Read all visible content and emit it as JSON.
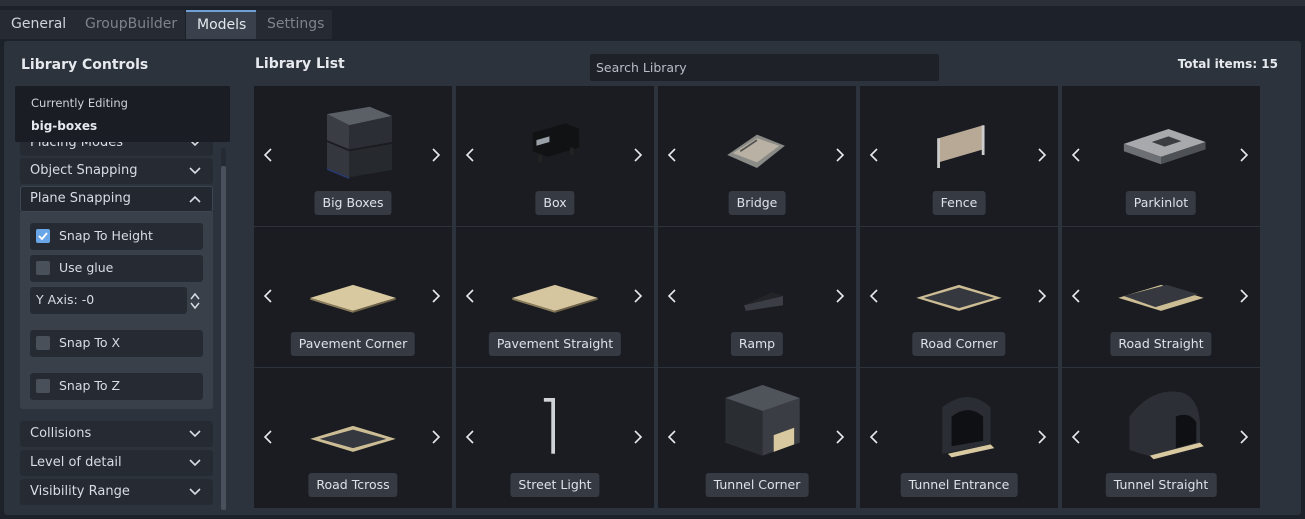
{
  "tabs": [
    {
      "label": "General"
    },
    {
      "label": "GroupBuilder"
    },
    {
      "label": "Models"
    },
    {
      "label": "Settings"
    }
  ],
  "left_panel": {
    "title": "Library Controls",
    "currently_editing_label": "Currently Editing",
    "currently_editing_value": "big-boxes",
    "placing_modes": "Placing Modes",
    "object_snapping": "Object Snapping",
    "plane_snapping": "Plane Snapping",
    "snap_to_height": "Snap To Height",
    "use_glue": "Use glue",
    "y_axis": "Y Axis:  -0",
    "snap_to_x": "Snap To X",
    "snap_to_z": "Snap To Z",
    "collisions": "Collisions",
    "level_of_detail": "Level of detail",
    "visibility_range": "Visibility Range"
  },
  "library": {
    "title": "Library List",
    "search_placeholder": "Search Library",
    "total": "Total items: 15",
    "items": [
      {
        "name": "Big Boxes",
        "icon": "big-boxes-model"
      },
      {
        "name": "Box",
        "icon": "box-model"
      },
      {
        "name": "Bridge",
        "icon": "bridge-model"
      },
      {
        "name": "Fence",
        "icon": "fence-model"
      },
      {
        "name": "Parkinlot",
        "icon": "parking-lot-model"
      },
      {
        "name": "Pavement Corner",
        "icon": "pavement-corner-model"
      },
      {
        "name": "Pavement Straight",
        "icon": "pavement-straight-model"
      },
      {
        "name": "Ramp",
        "icon": "ramp-model"
      },
      {
        "name": "Road Corner",
        "icon": "road-corner-model"
      },
      {
        "name": "Road Straight",
        "icon": "road-straight-model"
      },
      {
        "name": "Road Tcross",
        "icon": "road-tcross-model"
      },
      {
        "name": "Street Light",
        "icon": "street-light-model"
      },
      {
        "name": "Tunnel Corner",
        "icon": "tunnel-corner-model"
      },
      {
        "name": "Tunnel Entrance",
        "icon": "tunnel-entrance-model"
      },
      {
        "name": "Tunnel Straight",
        "icon": "tunnel-straight-model"
      }
    ]
  },
  "state": {
    "snap_to_height": true,
    "use_glue": false,
    "snap_to_x": false,
    "snap_to_z": false
  },
  "colors": {
    "accent": "#6aa5e8",
    "panel": "#2d333c",
    "tile": "#1a1c21"
  }
}
